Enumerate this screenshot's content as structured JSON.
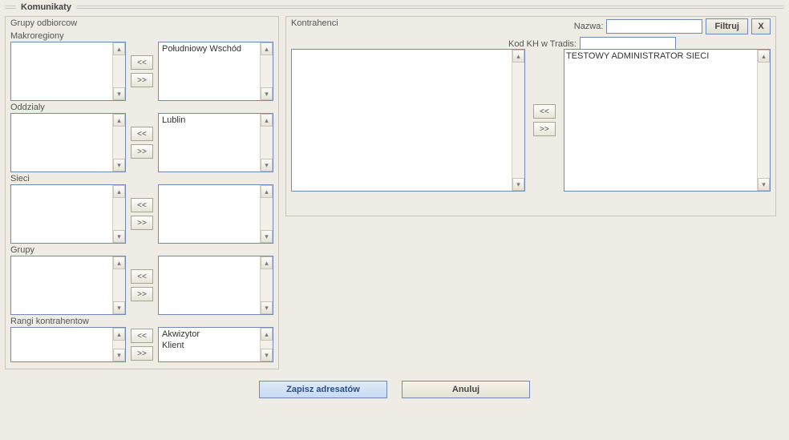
{
  "title": "Komunikaty",
  "left": {
    "panel_title": "Grupy odbiorcow",
    "sections": [
      {
        "label": "Makroregiony",
        "left_items": [],
        "right_items": [
          "Południowy Wschód"
        ],
        "short": false
      },
      {
        "label": "Oddzialy",
        "left_items": [],
        "right_items": [
          "Lublin"
        ],
        "short": false
      },
      {
        "label": "Sieci",
        "left_items": [],
        "right_items": [],
        "short": false
      },
      {
        "label": "Grupy",
        "left_items": [],
        "right_items": [],
        "short": false
      },
      {
        "label": "Rangi kontrahentow",
        "left_items": [],
        "right_items": [
          "Akwizytor",
          "Klient"
        ],
        "short": true
      }
    ],
    "move_left_label": "<<",
    "move_right_label": ">>"
  },
  "right": {
    "panel_title": "Kontrahenci",
    "filter_name_label": "Nazwa:",
    "filter_name_value": "",
    "filter_code_label": "Kod KH w Tradis:",
    "filter_code_value": "",
    "filter_button": "Filtruj",
    "close_button": "X",
    "available": [],
    "selected": [
      {
        "text": "TESTOWY ADMINISTRATOR SIECI",
        "selected": true
      }
    ],
    "move_left_label": "<<",
    "move_right_label": ">>"
  },
  "footer": {
    "save": "Zapisz adresatów",
    "cancel": "Anuluj"
  },
  "scrollbar": {
    "up": "▴",
    "down": "▾"
  }
}
